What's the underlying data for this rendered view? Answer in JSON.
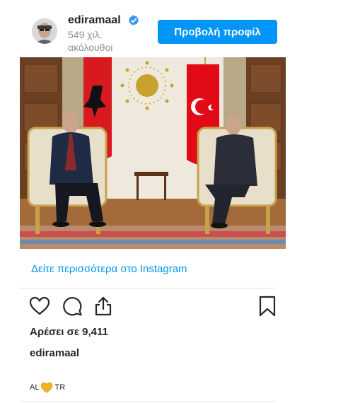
{
  "header": {
    "username": "ediramaal",
    "followers": "549 χιλ. ακόλουθοι",
    "profile_button": "Προβολή προφίλ",
    "verified_icon": "verified-badge-icon"
  },
  "colors": {
    "accent": "#0095f6",
    "text": "#262626",
    "muted": "#8e8e8e"
  },
  "post": {
    "photo_subject": "photo",
    "see_more": "Δείτε περισσότερα στο Instagram",
    "actions": [
      "heart-icon",
      "comment-icon",
      "share-icon",
      "bookmark-icon"
    ],
    "likes": "Αρέσει σε 9,411",
    "caption_user": "ediramaal",
    "caption_prefix": "AL",
    "caption_suffix": "TR",
    "caption_emoji": "yellow-heart-icon"
  }
}
